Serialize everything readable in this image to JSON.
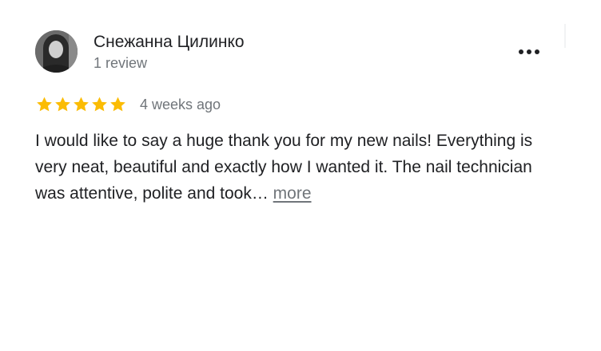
{
  "review": {
    "author": {
      "name": "Снежанна Цилинко",
      "review_count": "1 review"
    },
    "rating": {
      "stars": 5,
      "max": 5,
      "color": "#fbbc04"
    },
    "date": "4 weeks ago",
    "text": "I would like to say a huge thank you for my new nails! Everything is very neat, beautiful and exactly how I wanted it. The nail technician was attentive, polite and took… ",
    "more_label": "more"
  },
  "icons": {
    "menu": "more-vert-icon",
    "star": "star-icon"
  },
  "colors": {
    "text_primary": "#202124",
    "text_secondary": "#70757a",
    "star": "#fbbc04"
  }
}
